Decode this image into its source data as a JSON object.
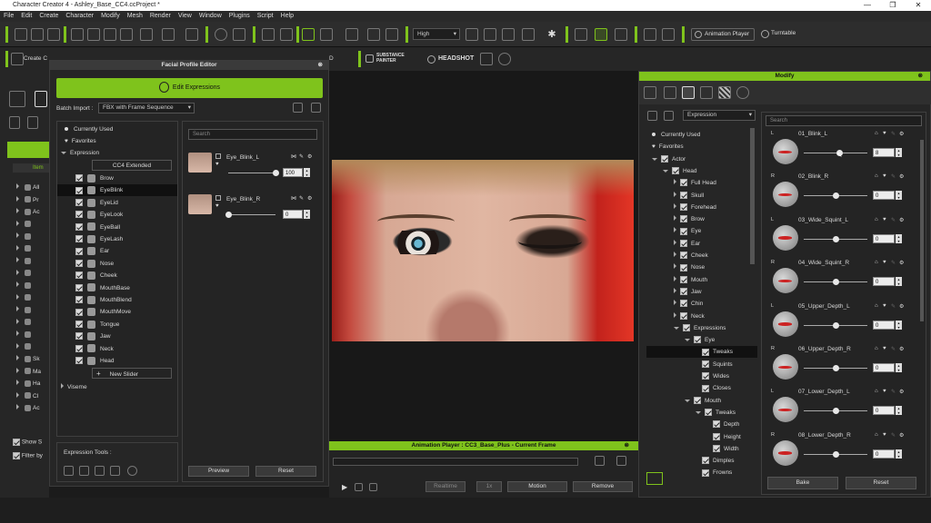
{
  "window": {
    "title": "Character Creator 4 - Ashley_Base_CC4.ccProject *",
    "min": "—",
    "max": "❐",
    "close": "✕"
  },
  "menu": [
    "File",
    "Edit",
    "Create",
    "Character",
    "Modify",
    "Mesh",
    "Render",
    "View",
    "Window",
    "Plugins",
    "Script",
    "Help"
  ],
  "toolbar": {
    "quality": "High",
    "animation_player": "Animation Player",
    "turntable": "Turntable",
    "create": "Create C",
    "substance": "SUBSTANCE PAINTER",
    "headshot": "HEADSHOT",
    "d_label": "D"
  },
  "facial_editor": {
    "title": "Facial Profile Editor",
    "edit_expressions": "Edit Expressions",
    "batch_import_label": "Batch Import :",
    "batch_import_value": "FBX with Frame Sequence",
    "tree": {
      "currently_used": "Currently Used",
      "favorites": "Favorites",
      "expression": "Expression",
      "cc4_extended": "CC4 Extended",
      "items": [
        "Brow",
        "EyeBlink",
        "EyeLid",
        "EyeLook",
        "EyeBall",
        "EyeLash",
        "Ear",
        "Nose",
        "Cheek",
        "MouthBase",
        "MouthBlend",
        "MouthMove",
        "Tongue",
        "Jaw",
        "Neck",
        "Head"
      ],
      "new_slider": "New Slider",
      "viseme": "Viseme"
    },
    "expression_tools": "Expression Tools :",
    "search_placeholder": "Search",
    "sliders": [
      {
        "name": "Eye_Blink_L",
        "value": "100"
      },
      {
        "name": "Eye_Blink_R",
        "value": "0"
      }
    ],
    "preview": "Preview",
    "reset": "Reset"
  },
  "left_stub": {
    "item_header": "Item",
    "rows": [
      "All",
      "Pr",
      "Ac",
      "",
      "",
      "",
      "",
      "",
      "",
      "",
      "",
      "",
      "",
      "",
      "Sk",
      "Ma",
      "Ha",
      "Cl",
      "Ac"
    ],
    "show": "Show S",
    "filter": "Filter by"
  },
  "animation_player": {
    "title": "Animation Player : CC3_Base_Plus - Current Frame",
    "realtime": "Realtime",
    "speed": "1x",
    "motion": "Motion",
    "remove": "Remove"
  },
  "modify": {
    "title": "Modify",
    "expression_dropdown": "Expression",
    "search_placeholder": "Search",
    "tree": [
      {
        "label": "Currently Used",
        "level": 0,
        "type": "dot"
      },
      {
        "label": "Favorites",
        "level": 0,
        "type": "heart"
      },
      {
        "label": "Actor",
        "level": 0,
        "type": "open"
      },
      {
        "label": "Head",
        "level": 1,
        "type": "open"
      },
      {
        "label": "Full Head",
        "level": 2,
        "type": "closed"
      },
      {
        "label": "Skull",
        "level": 2,
        "type": "closed"
      },
      {
        "label": "Forehead",
        "level": 2,
        "type": "closed"
      },
      {
        "label": "Brow",
        "level": 2,
        "type": "closed"
      },
      {
        "label": "Eye",
        "level": 2,
        "type": "closed"
      },
      {
        "label": "Ear",
        "level": 2,
        "type": "closed"
      },
      {
        "label": "Cheek",
        "level": 2,
        "type": "closed"
      },
      {
        "label": "Nose",
        "level": 2,
        "type": "closed"
      },
      {
        "label": "Mouth",
        "level": 2,
        "type": "closed"
      },
      {
        "label": "Jaw",
        "level": 2,
        "type": "closed"
      },
      {
        "label": "Chin",
        "level": 2,
        "type": "closed"
      },
      {
        "label": "Neck",
        "level": 2,
        "type": "closed"
      },
      {
        "label": "Expressions",
        "level": 2,
        "type": "open"
      },
      {
        "label": "Eye",
        "level": 3,
        "type": "open"
      },
      {
        "label": "Tweaks",
        "level": 4,
        "type": "leaf",
        "selected": true
      },
      {
        "label": "Squints",
        "level": 4,
        "type": "leaf"
      },
      {
        "label": "Wides",
        "level": 4,
        "type": "leaf"
      },
      {
        "label": "Closes",
        "level": 4,
        "type": "leaf"
      },
      {
        "label": "Mouth",
        "level": 3,
        "type": "open"
      },
      {
        "label": "Tweaks",
        "level": 4,
        "type": "open"
      },
      {
        "label": "Depth",
        "level": 5,
        "type": "leaf"
      },
      {
        "label": "Height",
        "level": 5,
        "type": "leaf"
      },
      {
        "label": "Width",
        "level": 5,
        "type": "leaf"
      },
      {
        "label": "Dimples",
        "level": 4,
        "type": "leaf"
      },
      {
        "label": "Frowns",
        "level": 4,
        "type": "leaf"
      }
    ],
    "sliders": [
      {
        "side": "L",
        "name": "01_Blink_L",
        "value": "8",
        "fraction": 0.55
      },
      {
        "side": "R",
        "name": "02_Blink_R",
        "value": "0",
        "fraction": 0.5
      },
      {
        "side": "L",
        "name": "03_Wide_Squint_L",
        "value": "0",
        "fraction": 0.5
      },
      {
        "side": "R",
        "name": "04_Wide_Squint_R",
        "value": "0",
        "fraction": 0.5
      },
      {
        "side": "L",
        "name": "05_Upper_Depth_L",
        "value": "0",
        "fraction": 0.5
      },
      {
        "side": "R",
        "name": "06_Upper_Depth_R",
        "value": "0",
        "fraction": 0.5
      },
      {
        "side": "L",
        "name": "07_Lower_Depth_L",
        "value": "0",
        "fraction": 0.5
      },
      {
        "side": "R",
        "name": "08_Lower_Depth_R",
        "value": "0",
        "fraction": 0.5
      }
    ],
    "bake": "Bake",
    "reset": "Reset"
  }
}
